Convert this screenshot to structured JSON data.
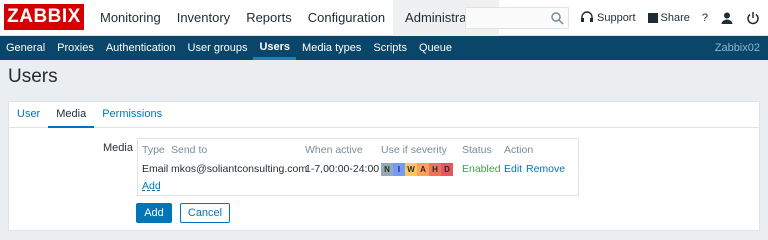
{
  "header": {
    "logo": "ZABBIX",
    "menu": [
      "Monitoring",
      "Inventory",
      "Reports",
      "Configuration",
      "Administration"
    ],
    "active_menu": "Administration",
    "search_placeholder": "",
    "support_label": "Support",
    "share_label": "Share",
    "help_label": "?"
  },
  "subnav": {
    "items": [
      "General",
      "Proxies",
      "Authentication",
      "User groups",
      "Users",
      "Media types",
      "Scripts",
      "Queue"
    ],
    "active": "Users",
    "server": "Zabbix02"
  },
  "page_title": "Users",
  "tabs": {
    "items": [
      "User",
      "Media",
      "Permissions"
    ],
    "active": "Media"
  },
  "media": {
    "label": "Media",
    "headers": {
      "type": "Type",
      "send_to": "Send to",
      "when_active": "When active",
      "severity": "Use if severity",
      "status": "Status",
      "action": "Action"
    },
    "row": {
      "type": "Email",
      "send_to": "mkos@soliantconsulting.com",
      "when_active": "1-7,00:00-24:00",
      "severity_letters": [
        "N",
        "I",
        "W",
        "A",
        "H",
        "D"
      ],
      "severity_colors": [
        "#97aab3",
        "#7499ff",
        "#ffc859",
        "#ffa059",
        "#e97659",
        "#e45959"
      ],
      "status": "Enabled",
      "edit": "Edit",
      "remove": "Remove"
    },
    "add_link": "Add"
  },
  "buttons": {
    "add": "Add",
    "cancel": "Cancel"
  },
  "colors": {
    "brand": "#d40000",
    "subnav_bg": "#0a466a",
    "link": "#0275b8",
    "enabled": "#429e47"
  }
}
